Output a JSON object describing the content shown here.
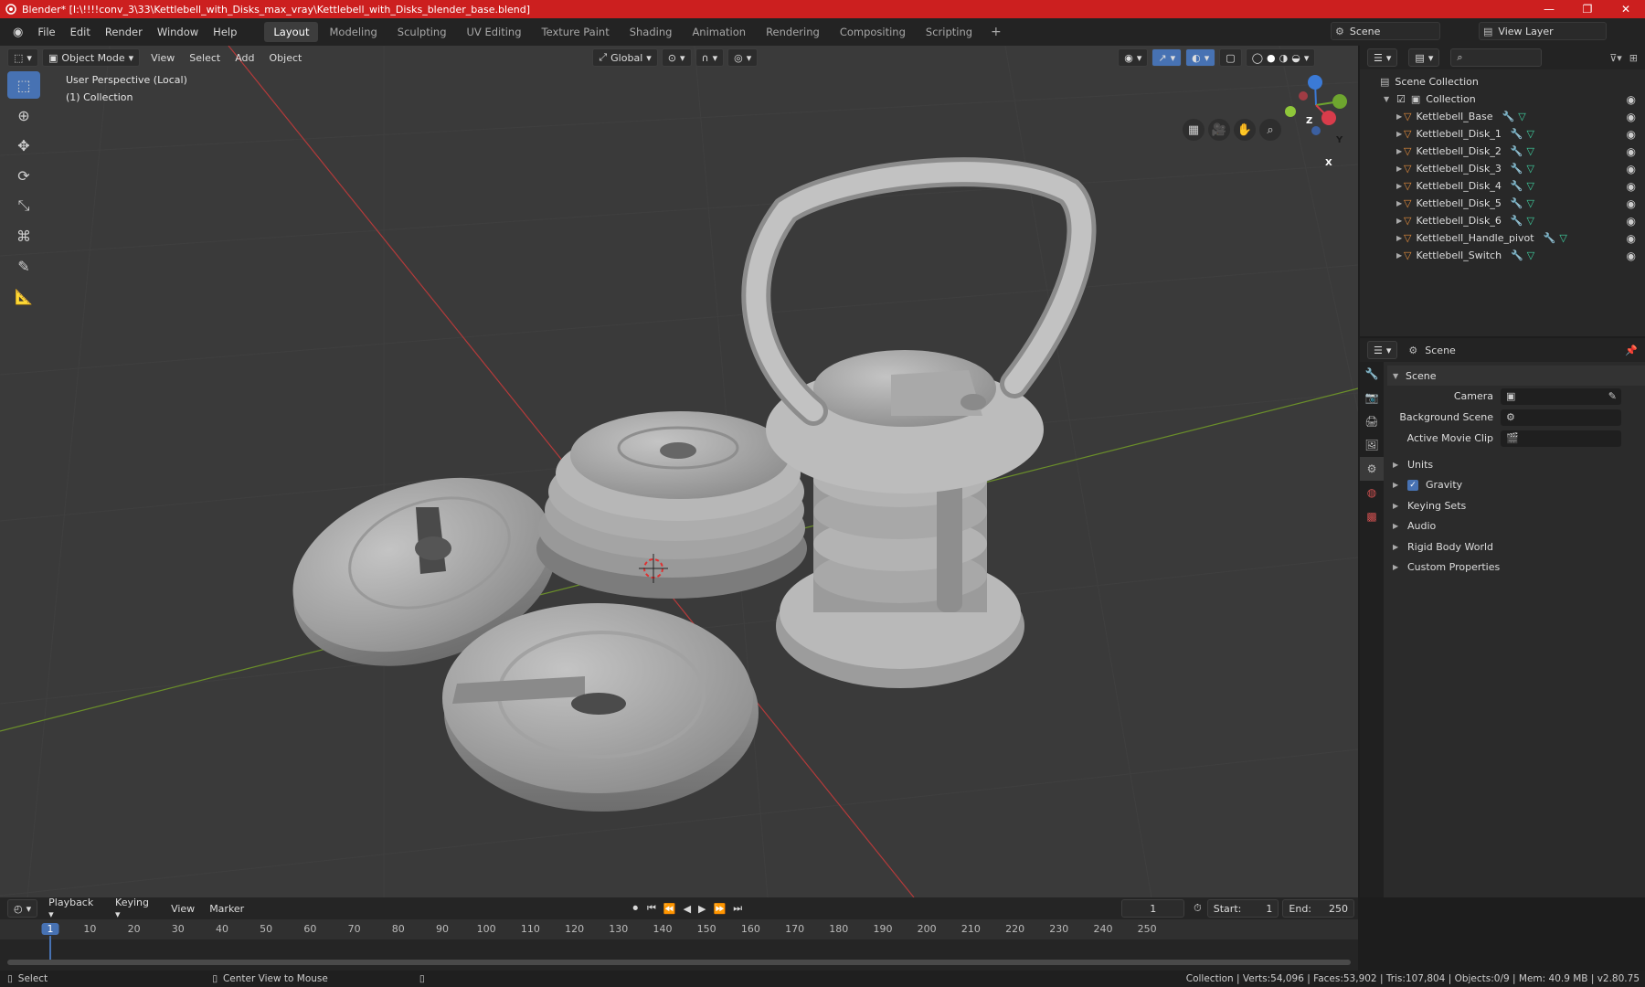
{
  "window": {
    "title": "Blender* [I:\\!!!!conv_3\\33\\Kettlebell_with_Disks_max_vray\\Kettlebell_with_Disks_blender_base.blend]",
    "controls": [
      "—",
      "❐",
      "✕"
    ]
  },
  "menu": [
    "File",
    "Edit",
    "Render",
    "Window",
    "Help"
  ],
  "workspaces": [
    "Layout",
    "Modeling",
    "Sculpting",
    "UV Editing",
    "Texture Paint",
    "Shading",
    "Animation",
    "Rendering",
    "Compositing",
    "Scripting"
  ],
  "scene_field": "Scene",
  "view_layer_field": "View Layer",
  "viewport": {
    "mode": "Object Mode",
    "menus": [
      "View",
      "Select",
      "Add",
      "Object"
    ],
    "transform": "Global",
    "info_line1": "User Perspective (Local)",
    "info_line2": "(1) Collection",
    "gizmo_axes": [
      "X",
      "Y",
      "Z"
    ]
  },
  "outliner": {
    "root": "Scene Collection",
    "collection": "Collection",
    "items": [
      "Kettlebell_Base",
      "Kettlebell_Disk_1",
      "Kettlebell_Disk_2",
      "Kettlebell_Disk_3",
      "Kettlebell_Disk_4",
      "Kettlebell_Disk_5",
      "Kettlebell_Disk_6",
      "Kettlebell_Handle_pivot",
      "Kettlebell_Switch"
    ]
  },
  "properties": {
    "context": "Scene",
    "panel": "Scene",
    "camera_label": "Camera",
    "bg_scene_label": "Background Scene",
    "movie_clip_label": "Active Movie Clip",
    "subpanels": [
      "Units",
      "Gravity",
      "Keying Sets",
      "Audio",
      "Rigid Body World",
      "Custom Properties"
    ]
  },
  "timeline": {
    "menus": [
      "Playback",
      "Keying",
      "View",
      "Marker"
    ],
    "current_frame": "1",
    "start_label": "Start:",
    "start": "1",
    "end_label": "End:",
    "end": "250",
    "ticks": [
      "1",
      "10",
      "20",
      "30",
      "40",
      "50",
      "60",
      "70",
      "80",
      "90",
      "100",
      "110",
      "120",
      "130",
      "140",
      "150",
      "160",
      "170",
      "180",
      "190",
      "200",
      "210",
      "220",
      "230",
      "240",
      "250"
    ]
  },
  "status": {
    "left1": "Select",
    "left2": "Center View to Mouse",
    "right": "Collection | Verts:54,096 | Faces:53,902 | Tris:107,804 | Objects:0/9 | Mem: 40.9 MB | v2.80.75"
  },
  "colors": {
    "titlebar": "#cc1f1f",
    "accent": "#4772b3",
    "grid_x": "#b53a3a",
    "grid_y": "#6b8f2a"
  }
}
